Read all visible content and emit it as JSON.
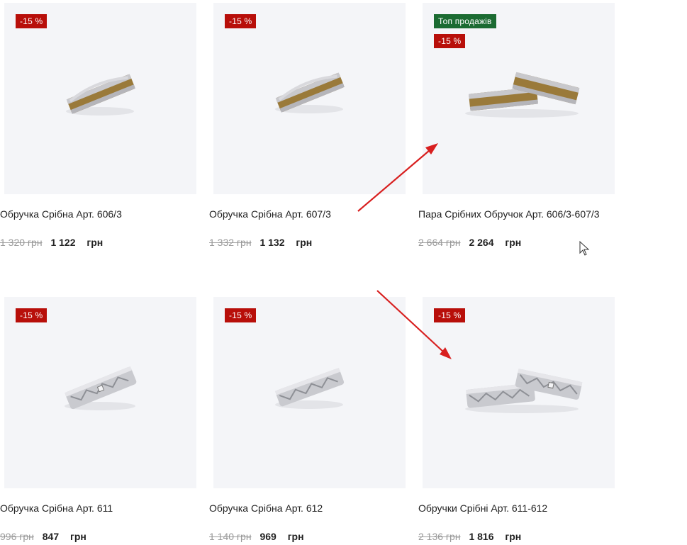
{
  "products": [
    {
      "badges": [
        "-15 %"
      ],
      "title": "Обручка Срібна Арт. 606/3",
      "old_price": "1 320 грн",
      "new_price": "1 122",
      "currency": "грн",
      "image": "gold-silver-ring-icon"
    },
    {
      "badges": [
        "-15 %"
      ],
      "title": "Обручка Срібна Арт. 607/3",
      "old_price": "1 332 грн",
      "new_price": "1 132",
      "currency": "грн",
      "image": "gold-silver-ring-icon"
    },
    {
      "top_badge": "Топ продажів",
      "badges": [
        "-15 %"
      ],
      "title": "Пара Срібних Обручок Арт. 606/3-607/3",
      "old_price": "2 664 грн",
      "new_price": "2 264",
      "currency": "грн",
      "image": "ring-pair-gold-icon"
    },
    {
      "badges": [
        "-15 %"
      ],
      "title": "Обручка Срібна Арт. 611",
      "old_price": "996 грн",
      "new_price": "847",
      "currency": "грн",
      "image": "silver-diamond-ring-icon"
    },
    {
      "badges": [
        "-15 %"
      ],
      "title": "Обручка Срібна Арт. 612",
      "old_price": "1 140 грн",
      "new_price": "969",
      "currency": "грн",
      "image": "silver-diamond-ring-icon"
    },
    {
      "badges": [
        "-15 %"
      ],
      "title": "Обручки Срібні Арт. 611-612",
      "old_price": "2 136 грн",
      "new_price": "1 816",
      "currency": "грн",
      "image": "ring-pair-silver-icon"
    }
  ],
  "colors": {
    "sale_badge": "#b80f0a",
    "top_badge": "#1b6b32",
    "card_bg": "#f4f5f8",
    "annotation_arrow": "#d81f1f"
  }
}
